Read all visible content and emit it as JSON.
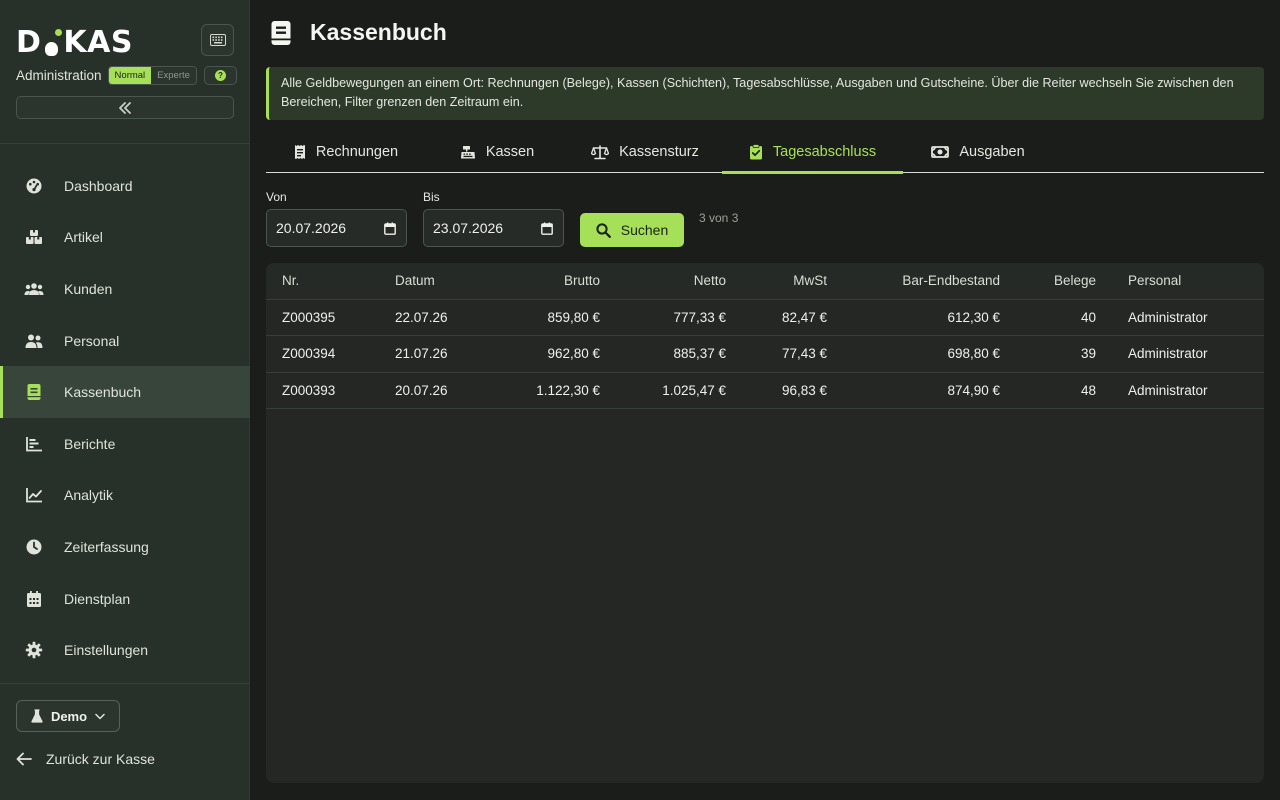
{
  "app": {
    "logo_text": "DIKAS",
    "section_label": "Administration",
    "mode_normal": "Normal",
    "mode_expert": "Experte",
    "help_label": "?"
  },
  "sidebar": {
    "items": [
      {
        "label": "Dashboard",
        "icon": "palette-icon"
      },
      {
        "label": "Artikel",
        "icon": "boxes-icon"
      },
      {
        "label": "Kunden",
        "icon": "users-icon"
      },
      {
        "label": "Personal",
        "icon": "staff-icon"
      },
      {
        "label": "Kassenbuch",
        "icon": "book-icon"
      },
      {
        "label": "Berichte",
        "icon": "bar-chart-icon"
      },
      {
        "label": "Analytik",
        "icon": "line-chart-icon"
      },
      {
        "label": "Zeiterfassung",
        "icon": "clock-icon"
      },
      {
        "label": "Dienstplan",
        "icon": "calendar-icon"
      },
      {
        "label": "Einstellungen",
        "icon": "gear-icon"
      }
    ],
    "active_item": "Kassenbuch",
    "demo_label": "Demo",
    "back_label": "Zurück zur Kasse"
  },
  "page": {
    "title": "Kassenbuch",
    "info_text": "Alle Geldbewegungen an einem Ort: Rechnungen (Belege), Kassen (Schichten), Tagesabschlüsse, Ausgaben und Gutscheine. Über die Reiter wechseln Sie zwischen den Bereichen, Filter grenzen den Zeitraum ein."
  },
  "tabs": [
    {
      "label": "Rechnungen",
      "icon": "receipt-icon"
    },
    {
      "label": "Kassen",
      "icon": "cash-register-icon"
    },
    {
      "label": "Kassensturz",
      "icon": "scale-icon"
    },
    {
      "label": "Tagesabschluss",
      "icon": "clipboard-check-icon"
    },
    {
      "label": "Ausgaben",
      "icon": "money-bill-icon"
    }
  ],
  "active_tab": "Tagesabschluss",
  "filter": {
    "from_label": "Von",
    "from_value": "20.07.2026",
    "to_label": "Bis",
    "to_value": "23.07.2026",
    "search_label": "Suchen",
    "result_count": "3 von 3"
  },
  "table": {
    "columns": [
      "Nr.",
      "Datum",
      "Brutto",
      "Netto",
      "MwSt",
      "Bar-Endbestand",
      "Belege",
      "Personal"
    ],
    "rows": [
      [
        "Z000395",
        "22.07.26",
        "859,80 €",
        "777,33 €",
        "82,47 €",
        "612,30 €",
        "40",
        "Administrator"
      ],
      [
        "Z000394",
        "21.07.26",
        "962,80 €",
        "885,37 €",
        "77,43 €",
        "698,80 €",
        "39",
        "Administrator"
      ],
      [
        "Z000393",
        "20.07.26",
        "1.122,30 €",
        "1.025,47 €",
        "96,83 €",
        "874,90 €",
        "48",
        "Administrator"
      ]
    ]
  },
  "colors": {
    "accent": "#a6e058",
    "sidebar_bg": "#273029",
    "main_bg": "#1b1d1a"
  }
}
